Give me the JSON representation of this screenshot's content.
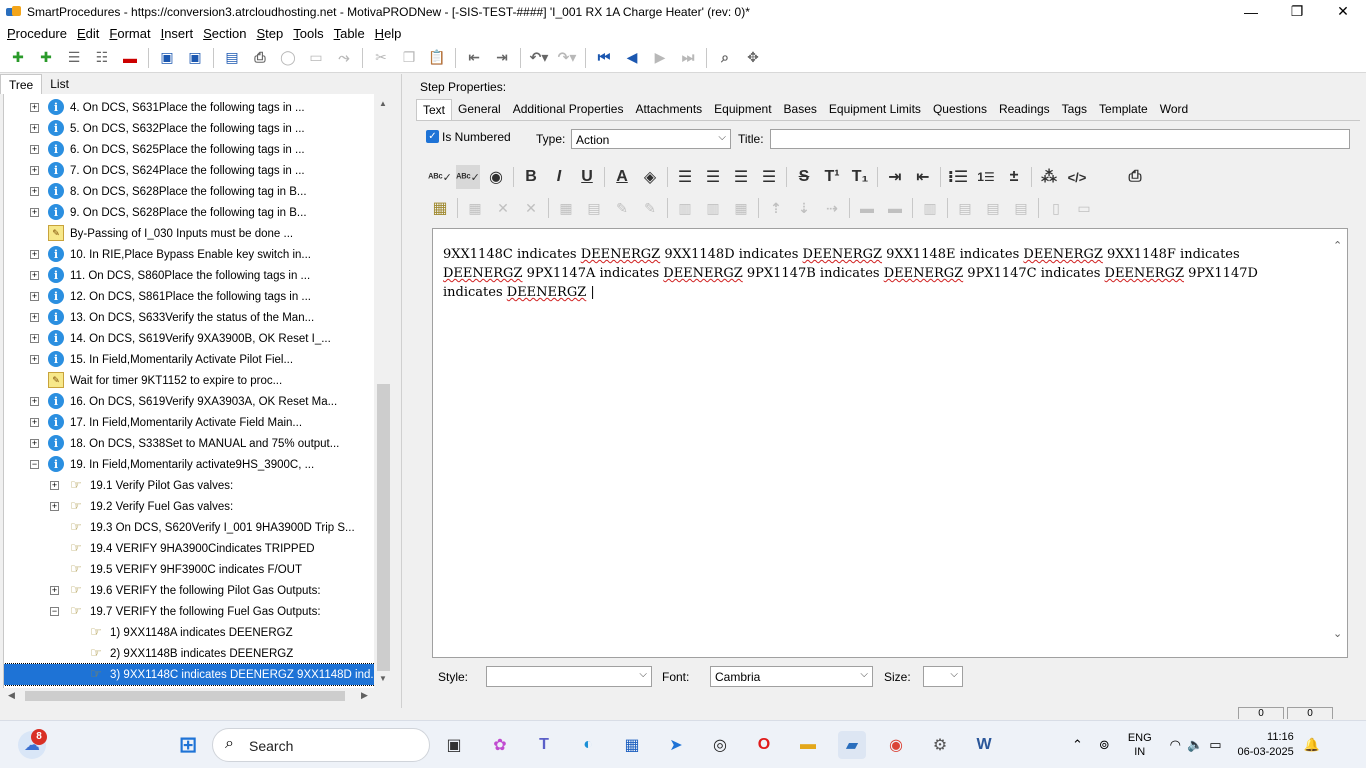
{
  "window": {
    "title": "SmartProcedures - https://conversion3.atrcloudhosting.net - MotivaPRODNew - [-SIS-TEST-####] 'I_001 RX 1A Charge Heater' (rev: 0)*",
    "minimize": "—",
    "maximize": "❐",
    "close": "✕"
  },
  "menu": [
    "Procedure",
    "Edit",
    "Format",
    "Insert",
    "Section",
    "Step",
    "Tools",
    "Table",
    "Help"
  ],
  "left_tabs": [
    "Tree",
    "List"
  ],
  "tree": [
    {
      "level": 0,
      "expander": "+",
      "icon": "info",
      "label": "4. On DCS, S631Place the following tags in ..."
    },
    {
      "level": 0,
      "expander": "+",
      "icon": "info",
      "label": "5. On DCS, S632Place the following tags in ..."
    },
    {
      "level": 0,
      "expander": "+",
      "icon": "info",
      "label": "6. On DCS, S625Place the following tags in ..."
    },
    {
      "level": 0,
      "expander": "+",
      "icon": "info",
      "label": "7. On DCS, S624Place the following tags in ..."
    },
    {
      "level": 0,
      "expander": "+",
      "icon": "info",
      "label": "8. On DCS, S628Place the following tag in B..."
    },
    {
      "level": 0,
      "expander": "+",
      "icon": "info",
      "label": "9. On DCS, S628Place the following tag in B..."
    },
    {
      "level": 0,
      "expander": "",
      "icon": "wait",
      "label": "By-Passing of I_030 Inputs must be done ..."
    },
    {
      "level": 0,
      "expander": "+",
      "icon": "info",
      "label": "10. In RIE,Place Bypass Enable key switch in..."
    },
    {
      "level": 0,
      "expander": "+",
      "icon": "info",
      "label": "11. On DCS, S860Place the following tags in ..."
    },
    {
      "level": 0,
      "expander": "+",
      "icon": "info",
      "label": "12. On DCS, S861Place the following tags in ..."
    },
    {
      "level": 0,
      "expander": "+",
      "icon": "info",
      "label": "13. On DCS, S633Verify the status of the Man..."
    },
    {
      "level": 0,
      "expander": "+",
      "icon": "info",
      "label": "14. On DCS, S619Verify 9XA3900B, OK Reset I_..."
    },
    {
      "level": 0,
      "expander": "+",
      "icon": "info",
      "label": "15. In Field,Momentarily Activate Pilot Fiel..."
    },
    {
      "level": 0,
      "expander": "",
      "icon": "wait",
      "label": "Wait for timer 9KT1152 to expire to proc..."
    },
    {
      "level": 0,
      "expander": "+",
      "icon": "info",
      "label": "16. On DCS, S619Verify 9XA3903A, OK Reset Ma..."
    },
    {
      "level": 0,
      "expander": "+",
      "icon": "info",
      "label": "17. In Field,Momentarily Activate Field Main..."
    },
    {
      "level": 0,
      "expander": "+",
      "icon": "info",
      "label": "18. On DCS, S338Set to MANUAL and 75% output..."
    },
    {
      "level": 0,
      "expander": "−",
      "icon": "info",
      "label": "19. In Field,Momentarily activate9HS_3900C, ..."
    },
    {
      "level": 1,
      "expander": "+",
      "icon": "hand",
      "label": "19.1 Verify Pilot Gas valves:"
    },
    {
      "level": 1,
      "expander": "+",
      "icon": "hand",
      "label": "19.2 Verify Fuel Gas valves:"
    },
    {
      "level": 1,
      "expander": "",
      "icon": "hand",
      "label": "19.3 On DCS, S620Verify I_001 9HA3900D Trip S..."
    },
    {
      "level": 1,
      "expander": "",
      "icon": "hand",
      "label": "19.4 VERIFY 9HA3900Cindicates TRIPPED"
    },
    {
      "level": 1,
      "expander": "",
      "icon": "hand",
      "label": "19.5 VERIFY 9HF3900C indicates F/OUT"
    },
    {
      "level": 1,
      "expander": "+",
      "icon": "hand",
      "label": "19.6 VERIFY the following Pilot Gas Outputs:"
    },
    {
      "level": 1,
      "expander": "−",
      "icon": "hand",
      "label": "19.7 VERIFY the following Fuel Gas Outputs:"
    },
    {
      "level": 2,
      "expander": "",
      "icon": "hand",
      "label": "1) 9XX1148A indicates DEENERGZ"
    },
    {
      "level": 2,
      "expander": "",
      "icon": "hand",
      "label": "2) 9XX1148B indicates DEENERGZ"
    },
    {
      "level": 2,
      "expander": "",
      "icon": "hand",
      "label": "3) 9XX1148C indicates DEENERGZ 9XX1148D ind...",
      "selected": true
    }
  ],
  "step_properties": {
    "heading": "Step Properties:",
    "tabs": [
      "Text",
      "General",
      "Additional Properties",
      "Attachments",
      "Equipment",
      "Bases",
      "Equipment Limits",
      "Questions",
      "Readings",
      "Tags",
      "Template",
      "Word"
    ],
    "is_numbered_label": "Is Numbered",
    "is_numbered": true,
    "type_label": "Type:",
    "type_value": "Action",
    "title_label": "Title:",
    "title_value": "",
    "style_label": "Style:",
    "style_value": "",
    "font_label": "Font:",
    "font_value": "Cambria",
    "size_label": "Size:",
    "size_value": ""
  },
  "editor_text": [
    {
      "t": "9XX1148C indicates "
    },
    {
      "t": "DEENERGZ",
      "sq": true
    },
    {
      "t": " 9XX1148D indicates "
    },
    {
      "t": "DEENERGZ",
      "sq": true
    },
    {
      "t": " 9XX1148E indicates "
    },
    {
      "t": "DEENERGZ",
      "sq": true
    },
    {
      "t": " 9XX1148F indicates "
    },
    {
      "t": "DEENERGZ",
      "sq": true
    },
    {
      "t": " 9PX1147A indicates "
    },
    {
      "t": "DEENERGZ",
      "sq": true
    },
    {
      "t": " 9PX1147B indicates "
    },
    {
      "t": "DEENERGZ",
      "sq": true
    },
    {
      "t": " 9PX1147C indicates "
    },
    {
      "t": "DEENERGZ",
      "sq": true
    },
    {
      "t": " 9PX1147D indicates "
    },
    {
      "t": "DEENERGZ",
      "sq": true
    },
    {
      "t": " |"
    }
  ],
  "status_boxes": [
    "0",
    "0"
  ],
  "taskbar": {
    "search_placeholder": "Search",
    "notification_count": "8",
    "lang": "ENG",
    "region": "IN",
    "time": "11:16",
    "date": "06-03-2025"
  }
}
